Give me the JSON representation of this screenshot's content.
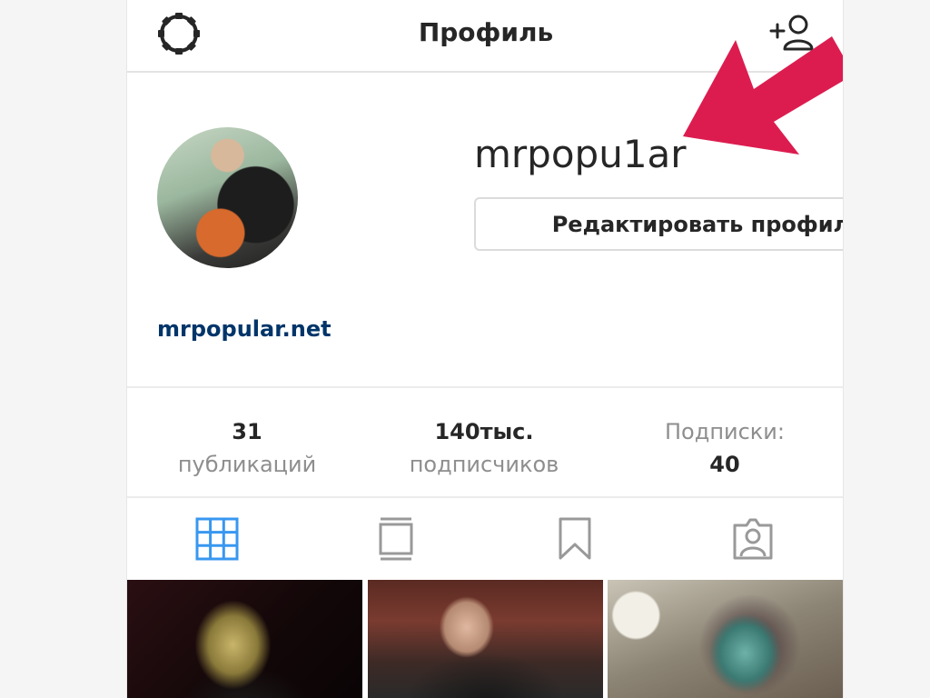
{
  "header": {
    "title": "Профиль"
  },
  "profile": {
    "username": "mrpopu1ar",
    "edit_button_label": "Редактировать профиль",
    "website": "mrpopular.net"
  },
  "stats": {
    "posts": {
      "value": "31",
      "label": "публикаций"
    },
    "followers": {
      "value": "140тыс.",
      "label": "подписчиков"
    },
    "following": {
      "label": "Подписки:",
      "value": "40"
    }
  },
  "tabs": [
    {
      "icon": "grid-icon",
      "active": true
    },
    {
      "icon": "feed-icon",
      "active": false
    },
    {
      "icon": "bookmark-icon",
      "active": false
    },
    {
      "icon": "tagged-person-icon",
      "active": false
    }
  ],
  "colors": {
    "accent_active_tab": "#3897f0",
    "inactive_icon": "#999999",
    "link": "#003569",
    "annotation_arrow": "#dc1c4f"
  }
}
